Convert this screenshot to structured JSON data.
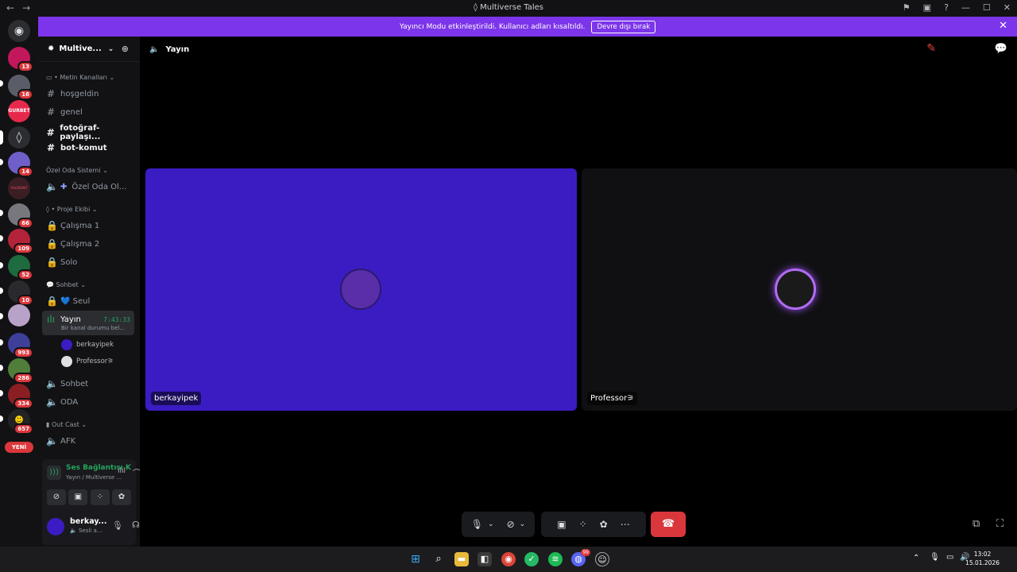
{
  "window": {
    "title": "Multiverse Tales"
  },
  "banner": {
    "message": "Yayıncı Modu etkinleştirildi. Kullanıcı adları kısaltıldı.",
    "button": "Devre dışı bırak"
  },
  "guilds": {
    "items": [
      {
        "icon": "discord-home-icon"
      },
      {
        "badge": "13"
      },
      {
        "badge": "16"
      },
      {
        "label": "GURBET"
      },
      {
        "badge": ""
      },
      {
        "badge": "14"
      },
      {
        "label": "VALORANT"
      },
      {
        "badge": "66"
      },
      {
        "badge": "109"
      },
      {
        "badge": "52"
      },
      {
        "badge": "10"
      },
      {
        "badge": ""
      },
      {
        "badge": "993"
      },
      {
        "badge": "286"
      },
      {
        "badge": "334"
      },
      {
        "badge": "657"
      }
    ],
    "new_label": "YENİ"
  },
  "server": {
    "name": "Multive...",
    "categories": {
      "text": "Metin Kanalları",
      "private": "Özel Oda Sistemi",
      "project": "Proje Ekibi",
      "chat": "Sohbet",
      "outcast": "Out Cast"
    },
    "channels": {
      "hosgeldin": "hoşgeldin",
      "genel": "genel",
      "fotograf": "fotoğraf-paylaşı...",
      "botkomut": "bot-komut",
      "ozeloda": "Özel Oda Ol...",
      "calisma1": "Çalışma 1",
      "calisma2": "Çalışma 2",
      "solo": "Solo",
      "seul": "💙 Seul",
      "yayin": "Yayın",
      "yayin_time": "7:43:33",
      "yayin_status": "Bir kanal durumu bel...",
      "sohbet": "Sohbet",
      "oda": "ODA",
      "afk": "AFK"
    },
    "voice_users": [
      "berkayipek",
      "Professor⚞"
    ]
  },
  "voice_panel": {
    "status": "Ses Bağlantısı K",
    "location": "Yayın / Multiverse ..."
  },
  "user_panel": {
    "name": "berkay...",
    "status": "Sesli a..."
  },
  "main": {
    "channel": "Yayın",
    "tiles": [
      {
        "name": "berkayipek"
      },
      {
        "name": "Professor⚞"
      }
    ]
  },
  "taskbar": {
    "discord_badge": "99",
    "time": "13:02",
    "date": "15.01.2026"
  },
  "colors": {
    "accent": "#7c35ea",
    "tile_purple": "#3b1cc2",
    "danger": "#da373c",
    "green": "#23a55a"
  }
}
